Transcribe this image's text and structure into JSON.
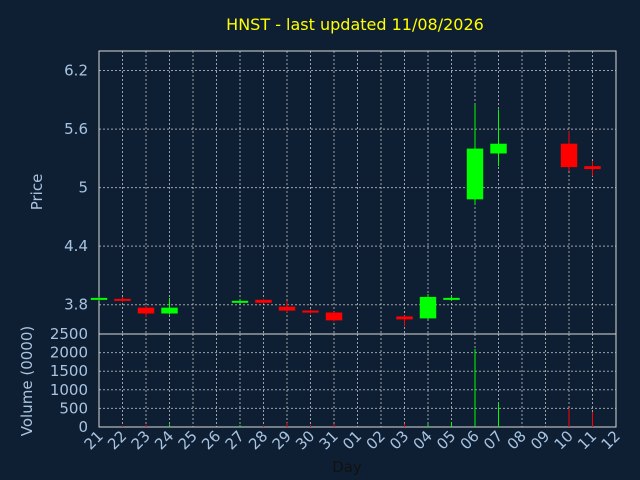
{
  "chart_data": {
    "type": "candlestick",
    "title": "HNST - last updated 11/08/2026",
    "xlabel": "Day",
    "x": [
      "21",
      "22",
      "23",
      "24",
      "25",
      "26",
      "27",
      "28",
      "29",
      "30",
      "31",
      "01",
      "02",
      "03",
      "04",
      "05",
      "06",
      "07",
      "08",
      "09",
      "10",
      "11",
      "12"
    ],
    "price_panel": {
      "ylabel": "Price",
      "ylim": [
        3.5,
        6.4
      ],
      "ticks": [
        6.2,
        5.6,
        5,
        4.4,
        3.8
      ]
    },
    "volume_panel": {
      "ylabel": "Volume (0000)",
      "ylim": [
        0,
        2500
      ],
      "ticks": [
        2500,
        2000,
        1500,
        1000,
        500,
        0
      ]
    },
    "candles": [
      {
        "day": "21",
        "open": 3.85,
        "high": 3.88,
        "low": 3.84,
        "close": 3.87,
        "volume": 5
      },
      {
        "day": "22",
        "open": 3.86,
        "high": 3.88,
        "low": 3.83,
        "close": 3.85,
        "volume": 40
      },
      {
        "day": "23",
        "open": 3.77,
        "high": 3.79,
        "low": 3.67,
        "close": 3.71,
        "volume": 60
      },
      {
        "day": "24",
        "open": 3.71,
        "high": 3.87,
        "low": 3.7,
        "close": 3.77,
        "volume": 70
      },
      {
        "day": "27",
        "open": 3.83,
        "high": 3.86,
        "low": 3.81,
        "close": 3.84,
        "volume": 50
      },
      {
        "day": "28",
        "open": 3.85,
        "high": 3.86,
        "low": 3.81,
        "close": 3.82,
        "volume": 40
      },
      {
        "day": "29",
        "open": 3.78,
        "high": 3.84,
        "low": 3.72,
        "close": 3.74,
        "volume": 110
      },
      {
        "day": "30",
        "open": 3.74,
        "high": 3.75,
        "low": 3.71,
        "close": 3.72,
        "volume": 60
      },
      {
        "day": "31",
        "open": 3.72,
        "high": 3.73,
        "low": 3.63,
        "close": 3.64,
        "volume": 80
      },
      {
        "day": "03",
        "open": 3.68,
        "high": 3.69,
        "low": 3.58,
        "close": 3.65,
        "volume": 90
      },
      {
        "day": "04",
        "open": 3.66,
        "high": 3.91,
        "low": 3.65,
        "close": 3.88,
        "volume": 80
      },
      {
        "day": "05",
        "open": 3.86,
        "high": 3.89,
        "low": 3.84,
        "close": 3.87,
        "volume": 130
      },
      {
        "day": "06",
        "open": 4.88,
        "high": 5.85,
        "low": 4.82,
        "close": 5.4,
        "volume": 2100
      },
      {
        "day": "07",
        "open": 5.35,
        "high": 5.8,
        "low": 5.22,
        "close": 5.45,
        "volume": 650
      },
      {
        "day": "10",
        "open": 5.45,
        "high": 5.58,
        "low": 5.17,
        "close": 5.21,
        "volume": 500
      },
      {
        "day": "11",
        "open": 5.22,
        "high": 5.27,
        "low": 5.12,
        "close": 5.19,
        "volume": 400
      }
    ],
    "colors": {
      "background": "#0f1f33",
      "plot_background": "#0f1f33",
      "up": "#00ff00",
      "down": "#ff0000",
      "grid": "#d8d8d8",
      "text": "#a8c4e0",
      "title": "#ffff00",
      "xlabel": "#111111"
    },
    "grid": true
  }
}
